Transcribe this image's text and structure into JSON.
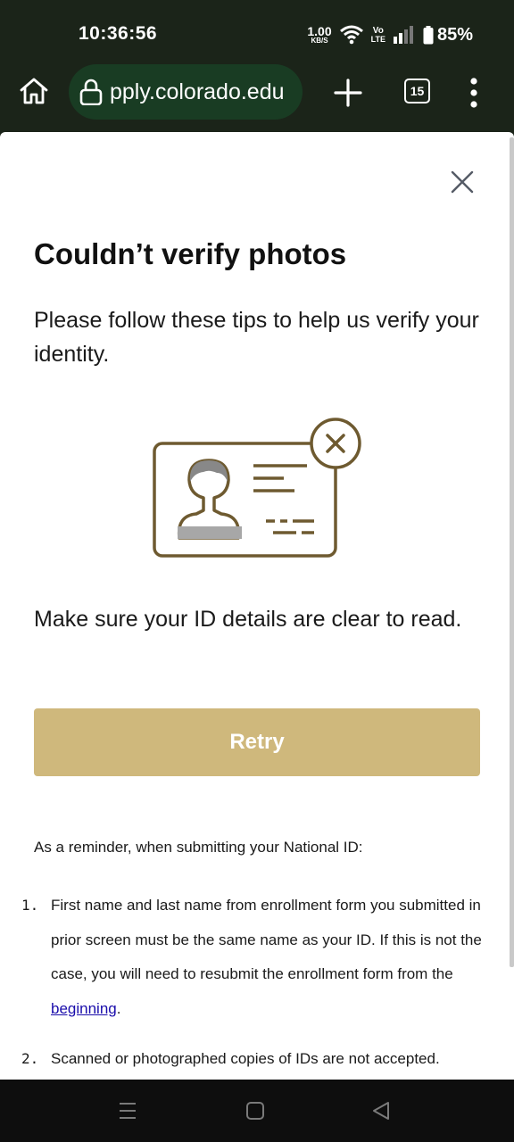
{
  "status_bar": {
    "time": "10:36:56",
    "net_speed": "1.00",
    "net_unit": "KB/S",
    "volte_top": "Vo",
    "volte_bottom": "LTE",
    "battery": "85%"
  },
  "browser": {
    "url": "pply.colorado.edu",
    "tab_count": "15",
    "home_icon": "home-icon",
    "lock_icon": "lock-icon",
    "new_tab_icon": "plus-icon",
    "menu_icon": "kebab-menu-icon"
  },
  "dialog": {
    "title": "Couldn’t verify photos",
    "subtitle": "Please follow these tips to help us verify your identity.",
    "hint": "Make sure your ID details are clear to read.",
    "retry_label": "Retry",
    "reminder_intro": "As a reminder, when submitting your National ID:",
    "list": [
      {
        "marker": "1.",
        "text_before": "First name and last name from enrollment form you submitted in prior screen must be the same name as your ID.  If this is not the case, you will need to resubmit the enrollment form from the ",
        "link": "beginning",
        "text_after": "."
      },
      {
        "marker": "2.",
        "text_before": "Scanned or photographed copies of IDs are not accepted."
      }
    ]
  },
  "colors": {
    "brand_gold": "#cfb87c",
    "illustration_brown": "#6e5a30",
    "browser_bg": "#1b2419",
    "url_pill": "#193c23"
  },
  "navbar": {
    "recent_icon": "recent-apps-icon",
    "home_icon": "home-square-icon",
    "back_icon": "back-triangle-icon"
  }
}
